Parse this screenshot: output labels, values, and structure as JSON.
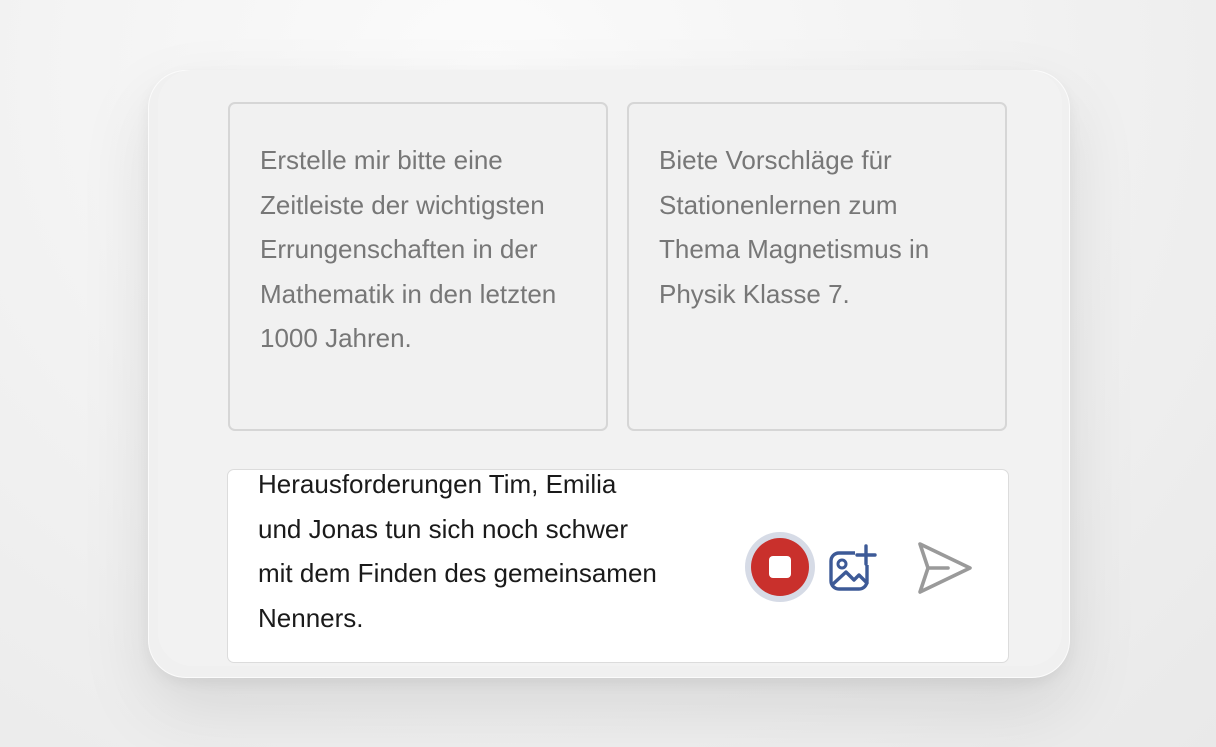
{
  "suggestions": [
    {
      "text": "Erstelle mir bitte eine Zeitleiste der wichtigsten Errungenschaften in der Mathematik in den letzten 1000 Jahren."
    },
    {
      "text": "Biete Vorschläge für Stationenlernen zum Thema Magnetismus in Physik Klasse 7."
    }
  ],
  "composer": {
    "value": "Herausforderungen Tim, Emilia\nund Jonas tun sich noch schwer\nmit dem Finden des gemeinsamen\nNenners."
  },
  "actions": {
    "stop_icon": "stop-icon",
    "image_icon": "add-image-icon",
    "send_icon": "send-icon"
  },
  "colors": {
    "stop_red": "#c9302c",
    "stop_ring": "#d6dbe6",
    "image_icon_blue": "#3d5a97",
    "send_icon_gray": "#9a9a9a",
    "suggestion_text": "#777777"
  }
}
